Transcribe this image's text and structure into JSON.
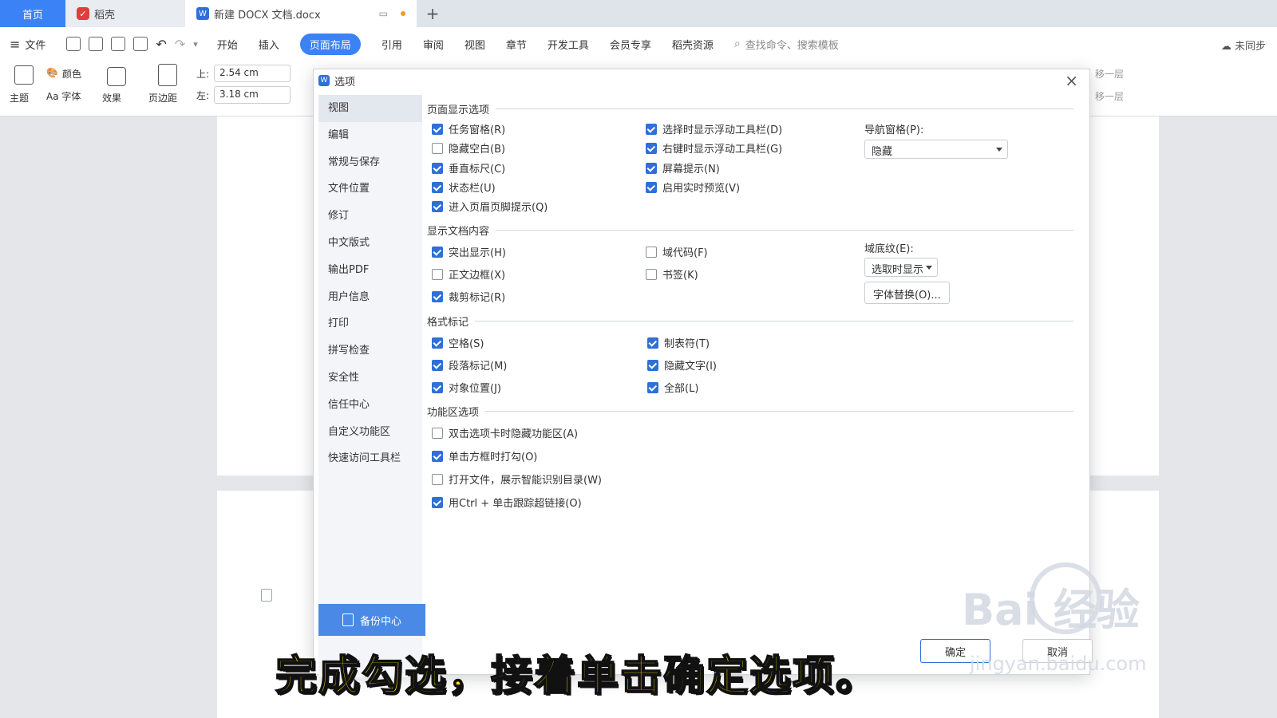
{
  "tabs": {
    "home": "首页",
    "docer": "稻壳",
    "doc": "新建 DOCX 文档.docx",
    "add": "+"
  },
  "menu": {
    "file": "文件",
    "items": [
      "开始",
      "插入",
      "页面布局",
      "引用",
      "审阅",
      "视图",
      "章节",
      "开发工具",
      "会员专享",
      "稻壳资源"
    ],
    "active_index": 2,
    "search_placeholder": "查找命令、搜索模板",
    "sync": "未同步"
  },
  "ribbon": {
    "theme": "主题",
    "color": "颜色",
    "font": "Aa 字体",
    "effect": "效果",
    "margin": "页边距",
    "top_label": "上:",
    "top_value": "2.54 cm",
    "left_label": "左:",
    "left_value": "3.18 cm",
    "move_up": "移一层",
    "move_down": "移一层"
  },
  "dialog": {
    "title": "选项",
    "close": "×",
    "sidebar": [
      "视图",
      "编辑",
      "常规与保存",
      "文件位置",
      "修订",
      "中文版式",
      "输出PDF",
      "用户信息",
      "打印",
      "拼写检查",
      "安全性",
      "信任中心",
      "自定义功能区",
      "快速访问工具栏"
    ],
    "sidebar_selected": 0,
    "backup": "备份中心",
    "sections": {
      "page_display": {
        "title": "页面显示选项",
        "col1": [
          {
            "label": "任务窗格(R)",
            "checked": true
          },
          {
            "label": "隐藏空白(B)",
            "checked": false
          },
          {
            "label": "垂直标尺(C)",
            "checked": true
          },
          {
            "label": "状态栏(U)",
            "checked": true
          },
          {
            "label": "进入页眉页脚提示(Q)",
            "checked": true
          }
        ],
        "col2": [
          {
            "label": "选择时显示浮动工具栏(D)",
            "checked": true
          },
          {
            "label": "右键时显示浮动工具栏(G)",
            "checked": true
          },
          {
            "label": "屏幕提示(N)",
            "checked": true
          },
          {
            "label": "启用实时预览(V)",
            "checked": true
          }
        ],
        "nav_label": "导航窗格(P):",
        "nav_value": "隐藏"
      },
      "doc_content": {
        "title": "显示文档内容",
        "col1": [
          {
            "label": "突出显示(H)",
            "checked": true
          },
          {
            "label": "正文边框(X)",
            "checked": false
          },
          {
            "label": "裁剪标记(R)",
            "checked": true
          }
        ],
        "col2": [
          {
            "label": "域代码(F)",
            "checked": false
          },
          {
            "label": "书签(K)",
            "checked": false
          }
        ],
        "shading_label": "域底纹(E):",
        "shading_value": "选取时显示",
        "font_sub": "字体替换(O)..."
      },
      "format_marks": {
        "title": "格式标记",
        "col1": [
          {
            "label": "空格(S)",
            "checked": true
          },
          {
            "label": "段落标记(M)",
            "checked": true
          },
          {
            "label": "对象位置(J)",
            "checked": true
          }
        ],
        "col2": [
          {
            "label": "制表符(T)",
            "checked": true
          },
          {
            "label": "隐藏文字(I)",
            "checked": true
          },
          {
            "label": "全部(L)",
            "checked": true
          }
        ]
      },
      "ribbon_options": {
        "title": "功能区选项",
        "items": [
          {
            "label": "双击选项卡时隐藏功能区(A)",
            "checked": false
          },
          {
            "label": "单击方框时打勾(O)",
            "checked": true
          },
          {
            "label": "打开文件，展示智能识别目录(W)",
            "checked": false
          },
          {
            "label": "用Ctrl + 单击跟踪超链接(O)",
            "checked": true
          }
        ]
      }
    },
    "ok": "确定",
    "cancel": "取消"
  },
  "overlay": {
    "caption": "完成勾选，接着单击确定选项。",
    "watermark": "Bai 经验",
    "watermark_url": "jingyan.baidu.com"
  },
  "colors": {
    "accent": "#3b82f6",
    "checkbox": "#2f6fd8",
    "caption": "#ffe600"
  }
}
